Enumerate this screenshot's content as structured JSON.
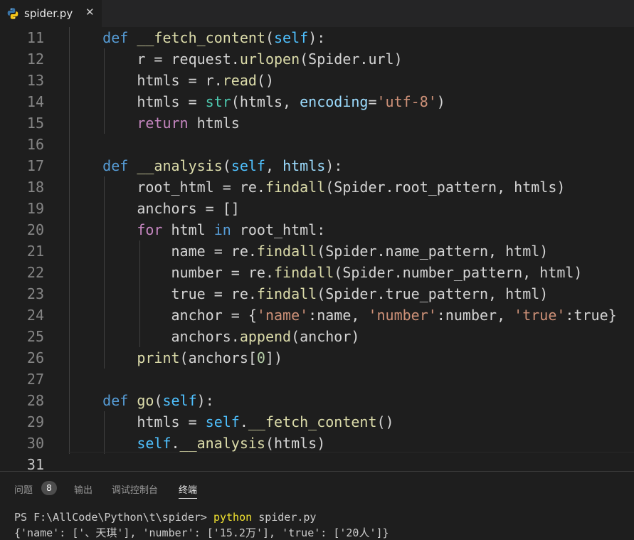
{
  "tab": {
    "file_name": "spider.py",
    "close_label": "✕",
    "icon": "python-icon"
  },
  "editor": {
    "lines": [
      {
        "n": "11",
        "code": "    def __fetch_content(self):"
      },
      {
        "n": "12",
        "code": "        r = request.urlopen(Spider.url)"
      },
      {
        "n": "13",
        "code": "        htmls = r.read()"
      },
      {
        "n": "14",
        "code": "        htmls = str(htmls, encoding='utf-8')"
      },
      {
        "n": "15",
        "code": "        return htmls"
      },
      {
        "n": "16",
        "code": ""
      },
      {
        "n": "17",
        "code": "    def __analysis(self, htmls):"
      },
      {
        "n": "18",
        "code": "        root_html = re.findall(Spider.root_pattern, htmls)"
      },
      {
        "n": "19",
        "code": "        anchors = []"
      },
      {
        "n": "20",
        "code": "        for html in root_html:"
      },
      {
        "n": "21",
        "code": "            name = re.findall(Spider.name_pattern, html)"
      },
      {
        "n": "22",
        "code": "            number = re.findall(Spider.number_pattern, html)"
      },
      {
        "n": "23",
        "code": "            true = re.findall(Spider.true_pattern, html)"
      },
      {
        "n": "24",
        "code": "            anchor = {'name':name, 'number':number, 'true':true}"
      },
      {
        "n": "25",
        "code": "            anchors.append(anchor)"
      },
      {
        "n": "26",
        "code": "        print(anchors[0])"
      },
      {
        "n": "27",
        "code": ""
      },
      {
        "n": "28",
        "code": "    def go(self):"
      },
      {
        "n": "29",
        "code": "        htmls = self.__fetch_content()"
      },
      {
        "n": "30",
        "code": "        self.__analysis(htmls)"
      },
      {
        "n": "31",
        "code": ""
      }
    ],
    "current_line": "31"
  },
  "panel": {
    "tabs": [
      "问题",
      "输出",
      "调试控制台",
      "终端"
    ],
    "active_tab": "终端",
    "problems_count": "8",
    "terminal": {
      "prompt": "PS F:\\AllCode\\Python\\t\\spider>",
      "command": "python",
      "argument": "spider.py",
      "output": "{'name': ['、天琪'], 'number': ['15.2万'], 'true': ['20人']}"
    }
  },
  "colors": {
    "background": "#1e1e1e",
    "keyword": "#569cd6",
    "function": "#dcdcaa",
    "self": "#4fc1ff",
    "control": "#c586c0",
    "string": "#ce9178",
    "terminal_command": "#f0e130"
  }
}
